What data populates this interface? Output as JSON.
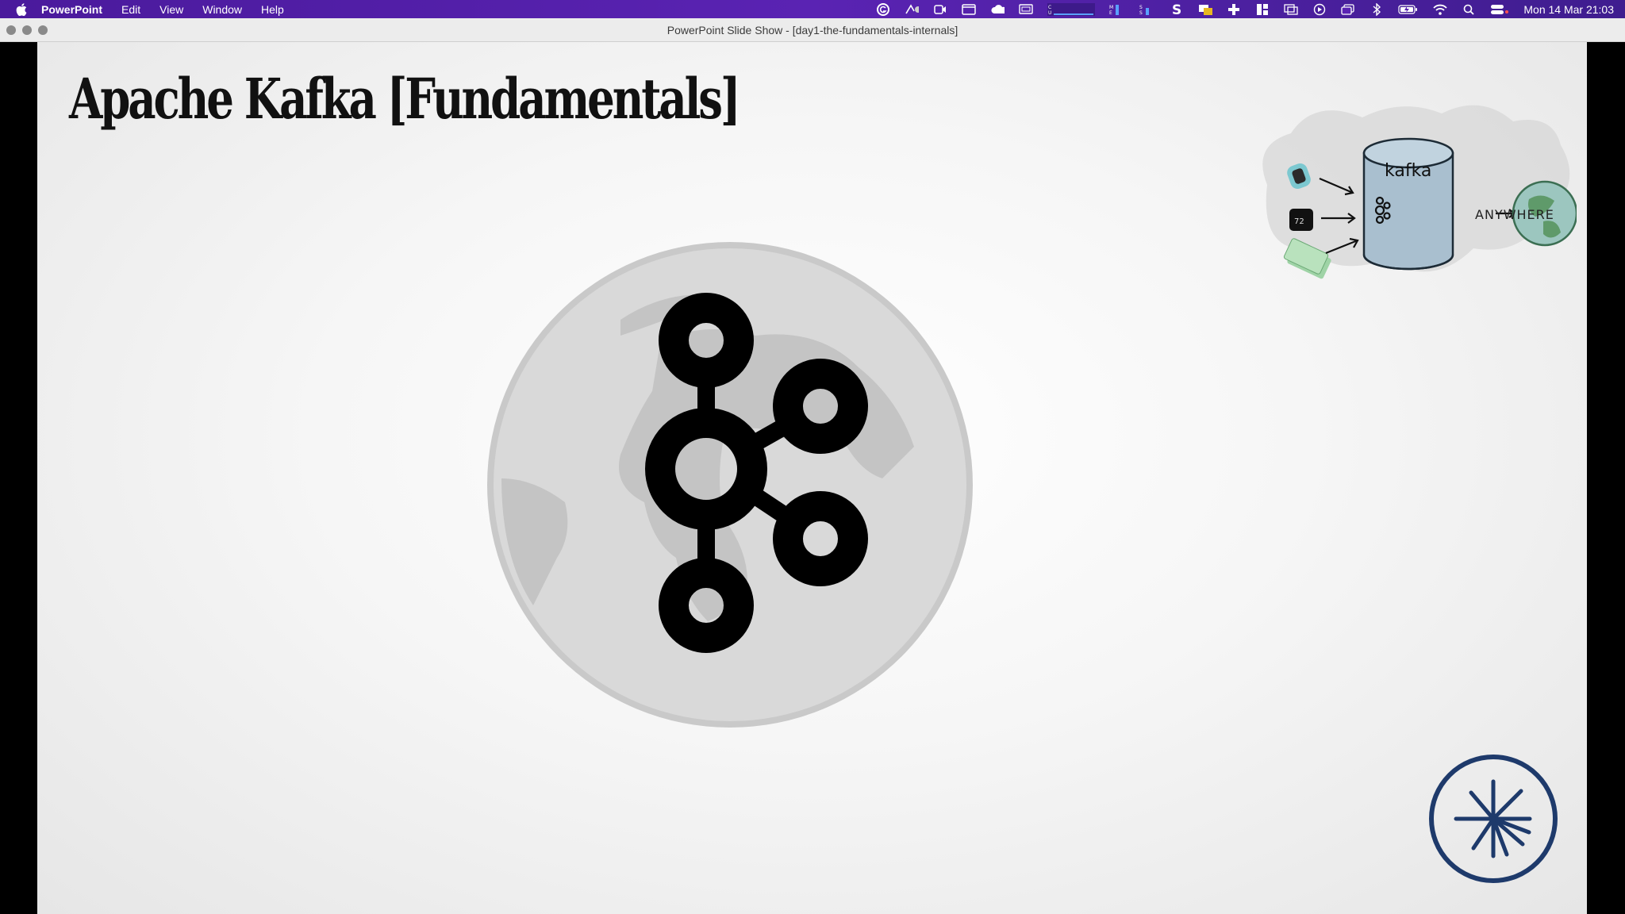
{
  "menubar": {
    "app_name": "PowerPoint",
    "items": [
      "Edit",
      "View",
      "Window",
      "Help"
    ],
    "status_icons": [
      "grammarly-icon",
      "screen-share-icon",
      "camera-icon",
      "window-icon",
      "cloud-icon",
      "display-icon",
      "cpu-graph-icon",
      "memory-graph-icon",
      "disk-graph-icon",
      "s-app-icon",
      "chat-icon",
      "plus-app-icon",
      "split-view-icon",
      "screen-mirror-icon",
      "play-icon",
      "stack-icon",
      "bluetooth-icon",
      "battery-icon",
      "wifi-icon",
      "search-icon",
      "control-center-icon"
    ],
    "clock": "Mon 14 Mar  21:03"
  },
  "window": {
    "title": "PowerPoint Slide Show - [day1-the-fundamentals-internals]"
  },
  "slide": {
    "title": "Apache Kafka [Fundamentals]",
    "diagram": {
      "center_label": "kafka",
      "destination_label": "ANYWHERE"
    }
  },
  "colors": {
    "menubar": "#4a1a9c",
    "confluent_navy": "#1e3a6b",
    "globe": "#d6d6d6"
  }
}
